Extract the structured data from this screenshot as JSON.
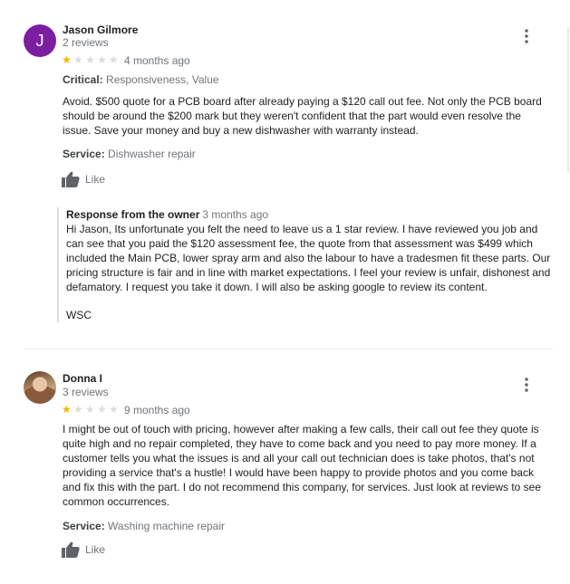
{
  "reviews": [
    {
      "avatar_letter": "J",
      "name": "Jason Gilmore",
      "review_count": "2 reviews",
      "rating": 1,
      "date": "4 months ago",
      "critical_label": "Critical:",
      "critical_value": "Responsiveness, Value",
      "text": "Avoid. $500 quote for a PCB board after already paying a $120 call out fee. Not only the PCB board should be around the $200 mark but they weren't confident that the part would even resolve the issue. Save your money and buy a new dishwasher with warranty instead.",
      "service_label": "Service:",
      "service_value": "Dishwasher repair",
      "like_label": "Like",
      "owner_response": {
        "heading": "Response from the owner",
        "date": "3 months ago",
        "text": "Hi Jason, Its unfortunate you felt the need to leave us a 1 star review. I have reviewed you job and can see that you paid the $120 assessment fee, the quote from that assessment was $499 which included the Main PCB, lower spray arm and also the labour to have a tradesmen fit these parts. Our pricing structure is fair and in line with market expectations. I feel your review is unfair, dishonest and defamatory. I request you take it down. I will also be asking google to review its content.",
        "signature": "WSC"
      }
    },
    {
      "name": "Donna I",
      "review_count": "3 reviews",
      "rating": 1,
      "date": "9 months ago",
      "text": "I might be out of touch with pricing, however after making a few calls,  their call out fee they quote is quite high and no repair completed, they have to come back and you need to pay more money. If a customer tells you what the issues is and all your call out technician does is take photos, that's not providing a service that's a hustle! I would have been happy to provide photos and you come back and fix this with the part. I do not recommend this company, for services. Just look at reviews to see common occurrences.",
      "service_label": "Service:",
      "service_value": "Washing machine repair",
      "like_label": "Like"
    }
  ],
  "icons": {
    "more": "more-vert-icon",
    "like": "thumb-up-icon",
    "star": "star-icon"
  },
  "colors": {
    "star_on": "#f4b400",
    "star_off": "#dadce0",
    "avatar_bg": "#7b1fa2"
  }
}
